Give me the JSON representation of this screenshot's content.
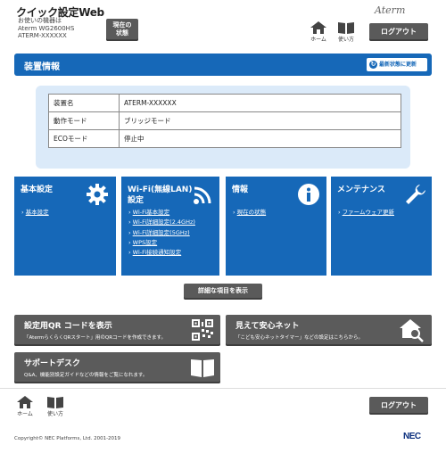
{
  "header": {
    "app_title": "クイック設定Web",
    "device_label": "お使いの機器は",
    "device_model": "Aterm WG2600HS",
    "device_name": "ATERM-XXXXXX",
    "status_button": "現在の\n状態",
    "brand": "Aterm",
    "home_label": "ホーム",
    "manual_label": "使い方",
    "logout_label": "ログアウト"
  },
  "section": {
    "title": "装置情報",
    "refresh_label": "最新状態に更新"
  },
  "device_table": [
    {
      "key": "装置名",
      "value": "ATERM-XXXXXX"
    },
    {
      "key": "動作モード",
      "value": "ブリッジモード"
    },
    {
      "key": "ECOモード",
      "value": "停止中"
    }
  ],
  "cards": {
    "basic": {
      "title": "基本設定",
      "links": [
        "基本設定"
      ]
    },
    "wifi": {
      "title_line1": "Wi-Fi(無線LAN)",
      "title_line2": "設定",
      "links": [
        "Wi-Fi基本設定",
        "Wi-Fi詳細設定(2.4GHz)",
        "Wi-Fi詳細設定(5GHz)",
        "WPS設定",
        "Wi-Fi接続通知設定"
      ]
    },
    "info": {
      "title": "情報",
      "links": [
        "現在の状態"
      ]
    },
    "maintenance": {
      "title": "メンテナンス",
      "links": [
        "ファームウェア更新"
      ]
    }
  },
  "details_button": "詳細な項目を表示",
  "qr_card": {
    "title": "設定用QR コードを表示",
    "desc": "「AtermらくらくQRスタート」用のQRコードを作成できます。"
  },
  "safety_card": {
    "title": "見えて安心ネット",
    "desc": "「こども安心ネットタイマー」などの設定はこちらから。"
  },
  "support_card": {
    "title": "サポートデスク",
    "desc": "Q&A、機能別設定ガイドなどの情報をご覧になれます。"
  },
  "footer": {
    "home_label": "ホーム",
    "manual_label": "使い方",
    "logout_label": "ログアウト",
    "copyright": "Copyright© NEC Platforms, Ltd. 2001-2019",
    "company": "NEC"
  },
  "colors": {
    "accent": "#1668b8",
    "panel": "#dbeaf9",
    "button": "#5a5a5a"
  },
  "icons": [
    "home-icon",
    "book-icon",
    "refresh-icon",
    "gear-icon",
    "wifi-icon",
    "info-icon",
    "wrench-icon",
    "qr-code-icon",
    "house-search-icon"
  ]
}
